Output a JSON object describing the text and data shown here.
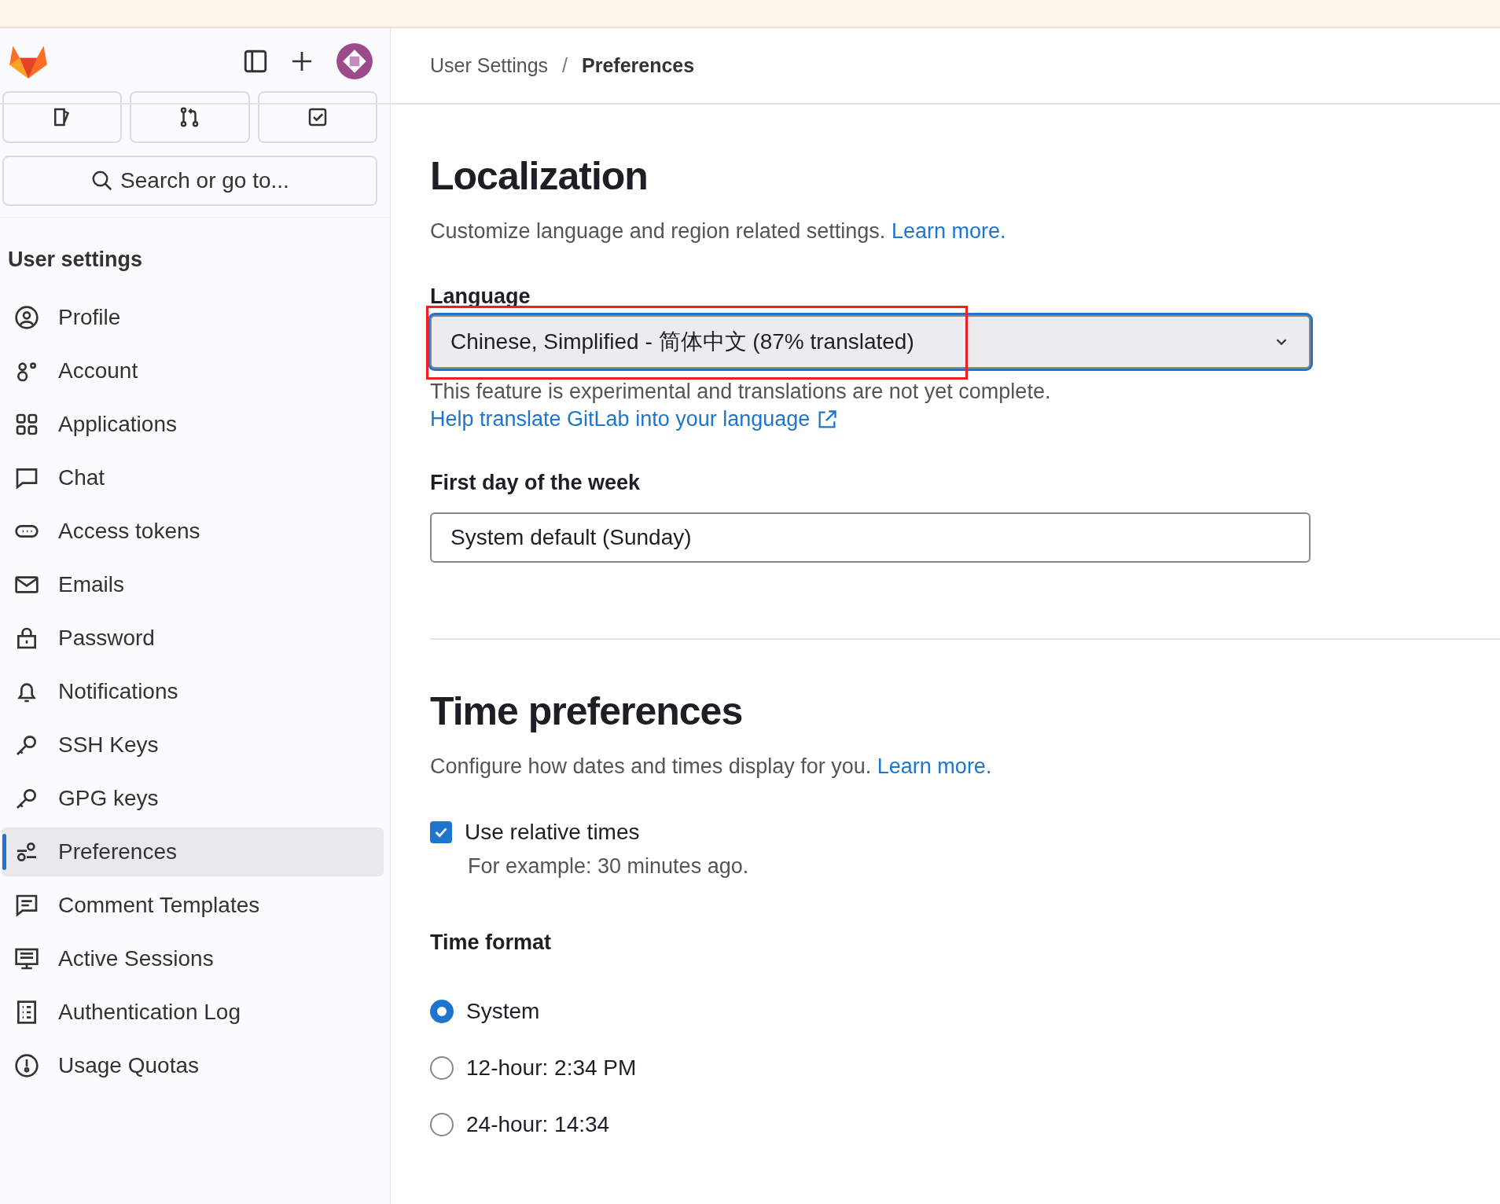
{
  "sidebar": {
    "search": {
      "placeholder": "Search or go to..."
    },
    "heading": "User settings",
    "items": [
      {
        "label": "Profile",
        "selected": false
      },
      {
        "label": "Account",
        "selected": false
      },
      {
        "label": "Applications",
        "selected": false
      },
      {
        "label": "Chat",
        "selected": false
      },
      {
        "label": "Access tokens",
        "selected": false
      },
      {
        "label": "Emails",
        "selected": false
      },
      {
        "label": "Password",
        "selected": false
      },
      {
        "label": "Notifications",
        "selected": false
      },
      {
        "label": "SSH Keys",
        "selected": false
      },
      {
        "label": "GPG keys",
        "selected": false
      },
      {
        "label": "Preferences",
        "selected": true
      },
      {
        "label": "Comment Templates",
        "selected": false
      },
      {
        "label": "Active Sessions",
        "selected": false
      },
      {
        "label": "Authentication Log",
        "selected": false
      },
      {
        "label": "Usage Quotas",
        "selected": false
      }
    ]
  },
  "breadcrumb": [
    "User Settings",
    "Preferences"
  ],
  "breadcrumb_separator": "/",
  "localization": {
    "title": "Localization",
    "description": "Customize language and region related settings.",
    "learn_more": "Learn more.",
    "language_label": "Language",
    "language_value": "Chinese, Simplified - 简体中文 (87% translated)",
    "language_help": "This feature is experimental and translations are not yet complete.",
    "help_link": "Help translate GitLab into your language",
    "first_day_label": "First day of the week",
    "first_day_value": "System default (Sunday)"
  },
  "time": {
    "title": "Time preferences",
    "description": "Configure how dates and times display for you.",
    "learn_more": "Learn more.",
    "relative_label": "Use relative times",
    "relative_checked": true,
    "relative_example": "For example: 30 minutes ago.",
    "format_label": "Time format",
    "formats": [
      {
        "label": "System",
        "selected": true
      },
      {
        "label": "12-hour: 2:34 PM",
        "selected": false
      },
      {
        "label": "24-hour: 14:34",
        "selected": false
      }
    ]
  }
}
